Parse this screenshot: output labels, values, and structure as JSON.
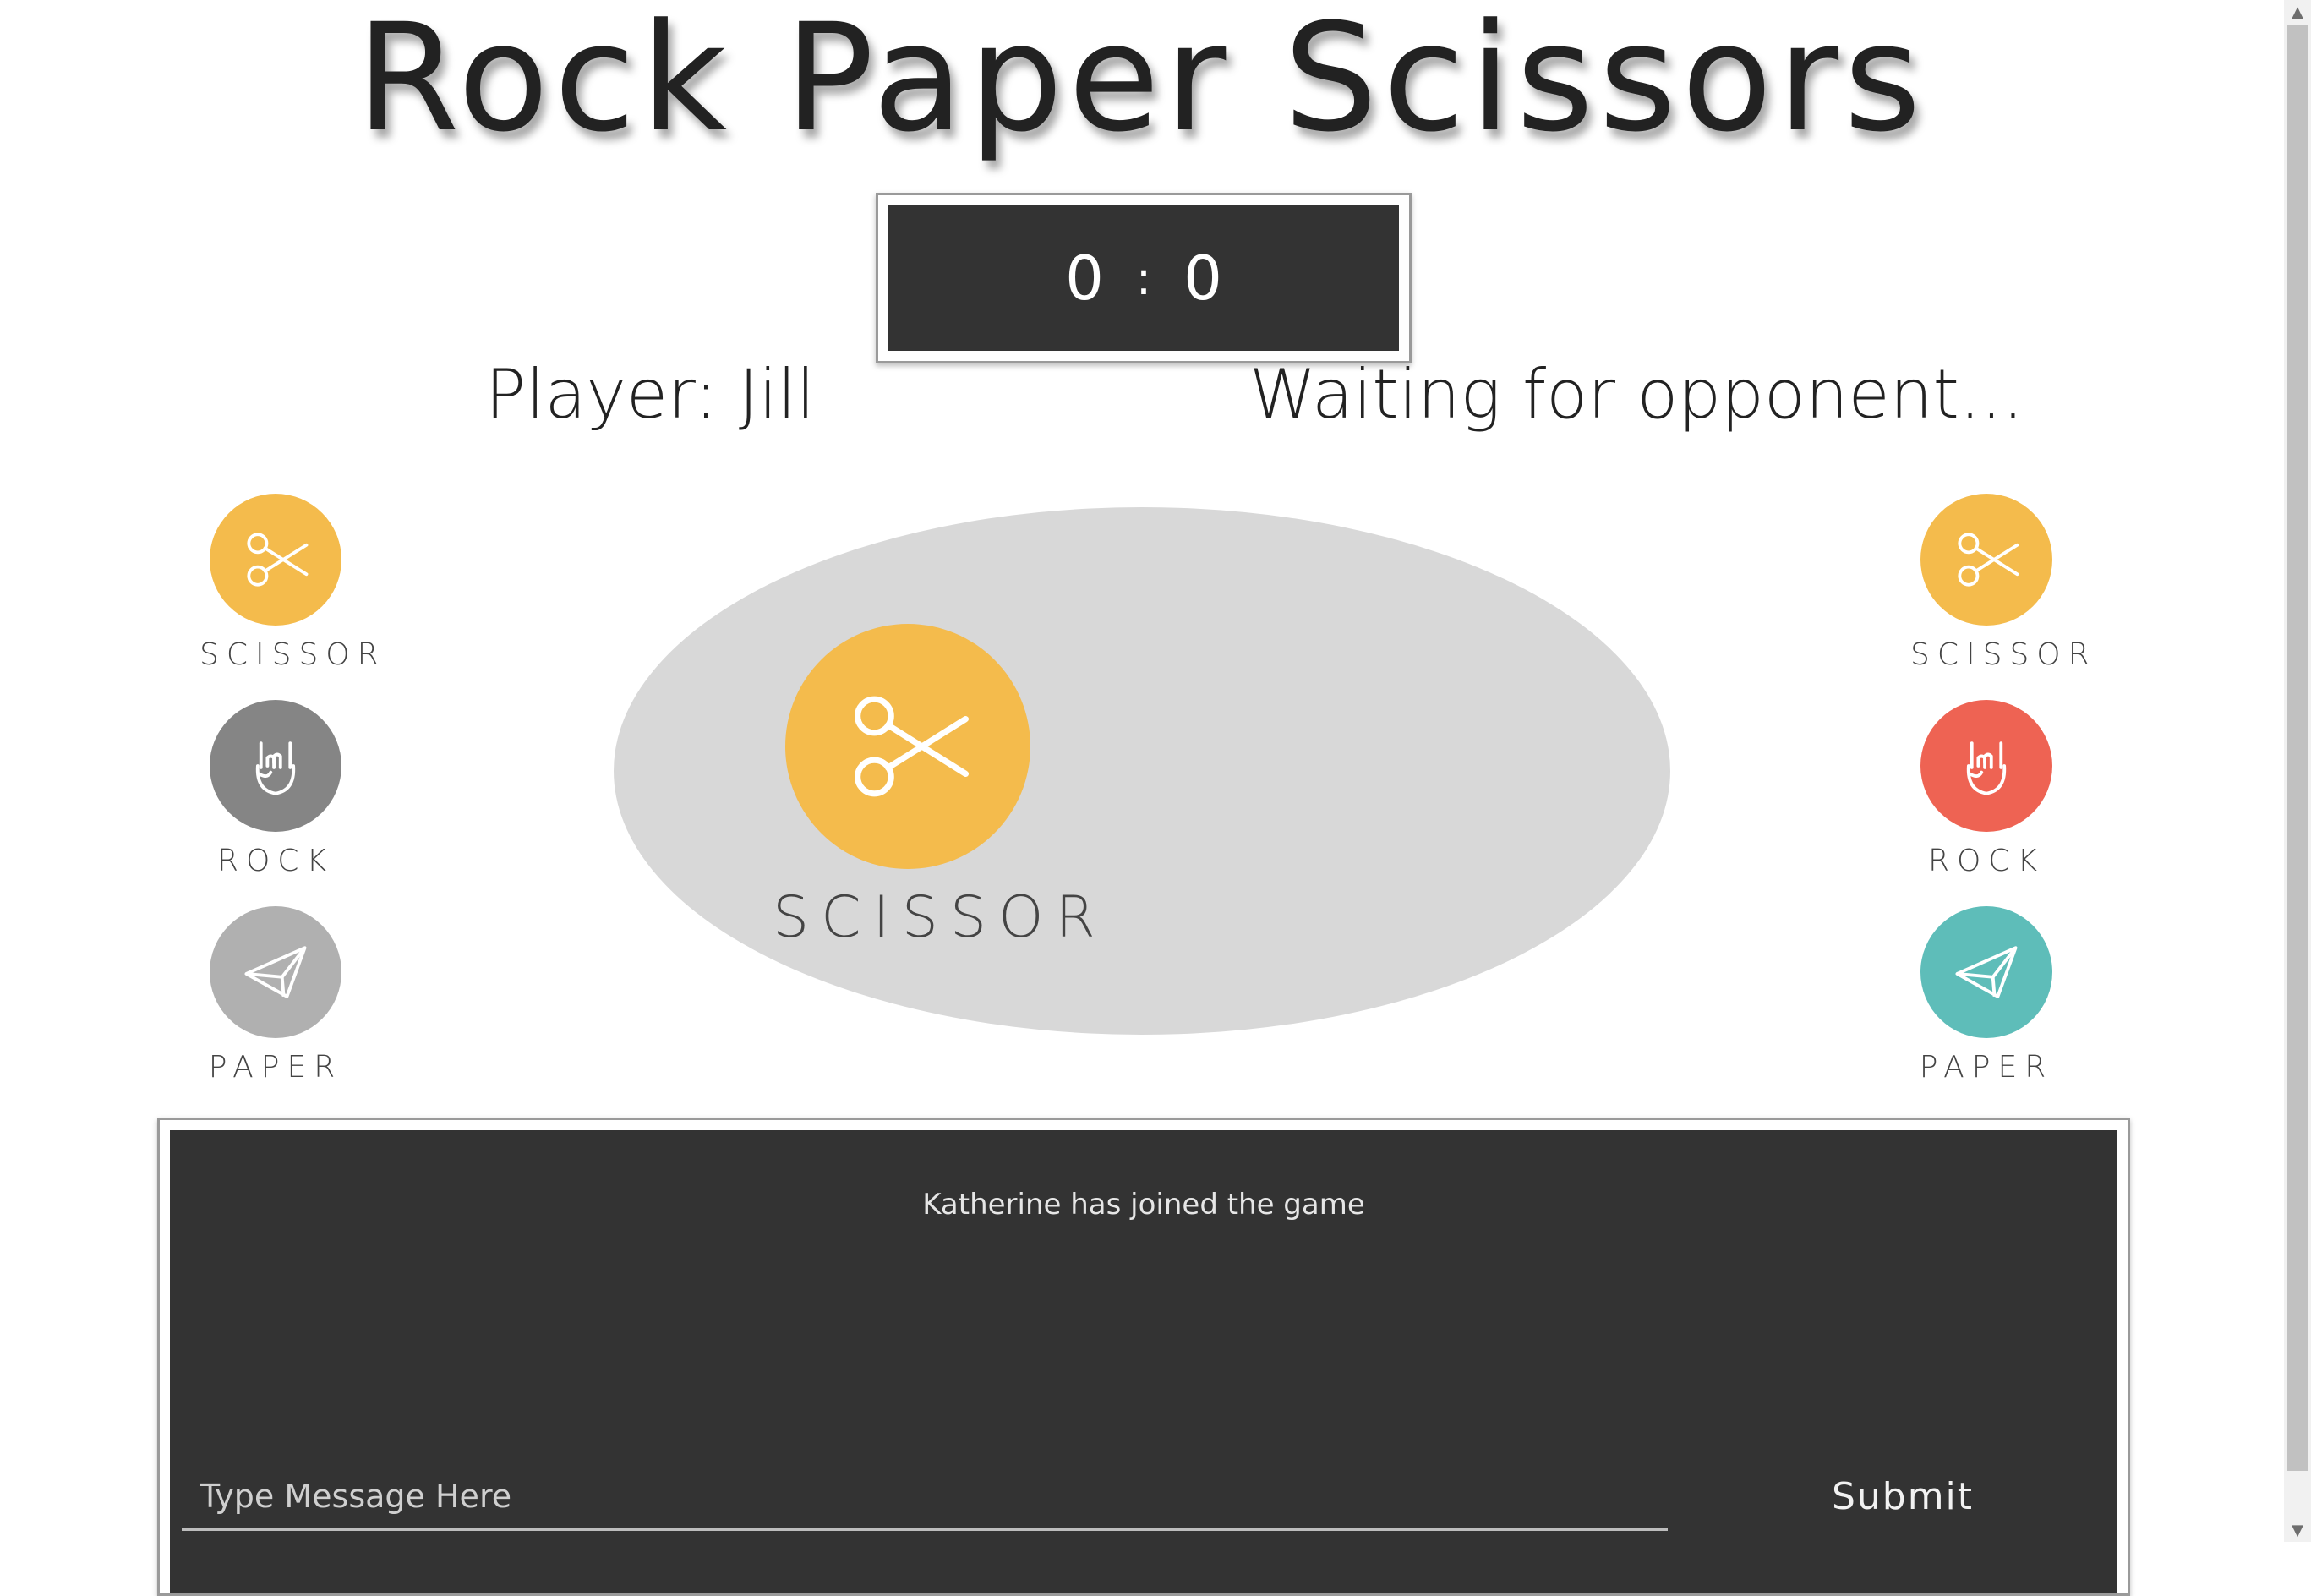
{
  "title": "Rock Paper Scissors",
  "score": {
    "player": "0",
    "separator": ":",
    "opponent": "0"
  },
  "player": {
    "label": "Player: Jill"
  },
  "opponent": {
    "status": "Waiting for opponent..."
  },
  "colors": {
    "scissor": "#f4bb4c",
    "rock_inactive": "#858585",
    "paper_inactive": "#b0b0b0",
    "rock_active": "#ee6353",
    "paper_active": "#5ebdb9",
    "arena": "#d8d8d8",
    "panel_dark": "#333333"
  },
  "player_choices": [
    {
      "id": "scissor",
      "label": "SCISSOR",
      "icon": "scissors-icon"
    },
    {
      "id": "rock",
      "label": "ROCK",
      "icon": "rock-hand-icon"
    },
    {
      "id": "paper",
      "label": "PAPER",
      "icon": "paper-plane-icon"
    }
  ],
  "opponent_choices": [
    {
      "id": "scissor",
      "label": "SCISSOR",
      "icon": "scissors-icon"
    },
    {
      "id": "rock",
      "label": "ROCK",
      "icon": "rock-hand-icon"
    },
    {
      "id": "paper",
      "label": "PAPER",
      "icon": "paper-plane-icon"
    }
  ],
  "selected": {
    "label": "SCISSOR",
    "icon": "scissors-icon"
  },
  "chat": {
    "messages": [
      "Katherine has joined the game"
    ],
    "input_placeholder": "Type Message Here",
    "submit_label": "Submit"
  }
}
